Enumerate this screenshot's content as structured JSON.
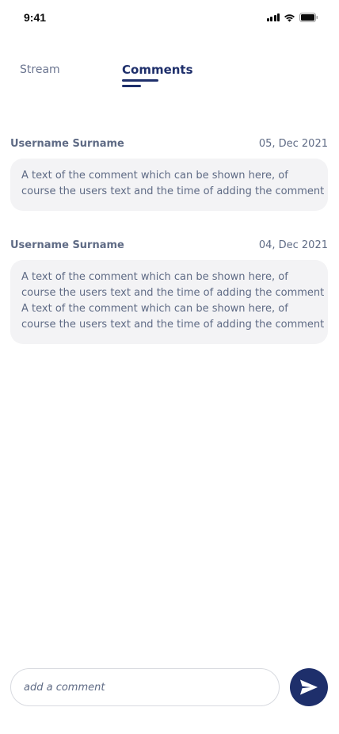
{
  "status_bar": {
    "time": "9:41"
  },
  "tabs": [
    {
      "label": "Stream",
      "active": false
    },
    {
      "label": "Comments",
      "active": true
    }
  ],
  "comments": [
    {
      "author": "Username Surname",
      "date": "05, Dec 2021",
      "lines": [
        "A text of the comment which can be shown here, of",
        "course the users text and the time of adding the comment"
      ]
    },
    {
      "author": "Username Surname",
      "date": "04, Dec 2021",
      "lines": [
        "A text of the comment which can be shown here, of",
        "course the users text and the time of adding the comment",
        "A text of the comment which can be shown here, of",
        "course the users text and the time of adding the comment"
      ]
    }
  ],
  "composer": {
    "placeholder": "add a comment",
    "value": "",
    "send_icon": "send-icon"
  },
  "colors": {
    "accent": "#1e2f6b",
    "text": "#5f6b85",
    "bubble": "#f3f3f5"
  }
}
